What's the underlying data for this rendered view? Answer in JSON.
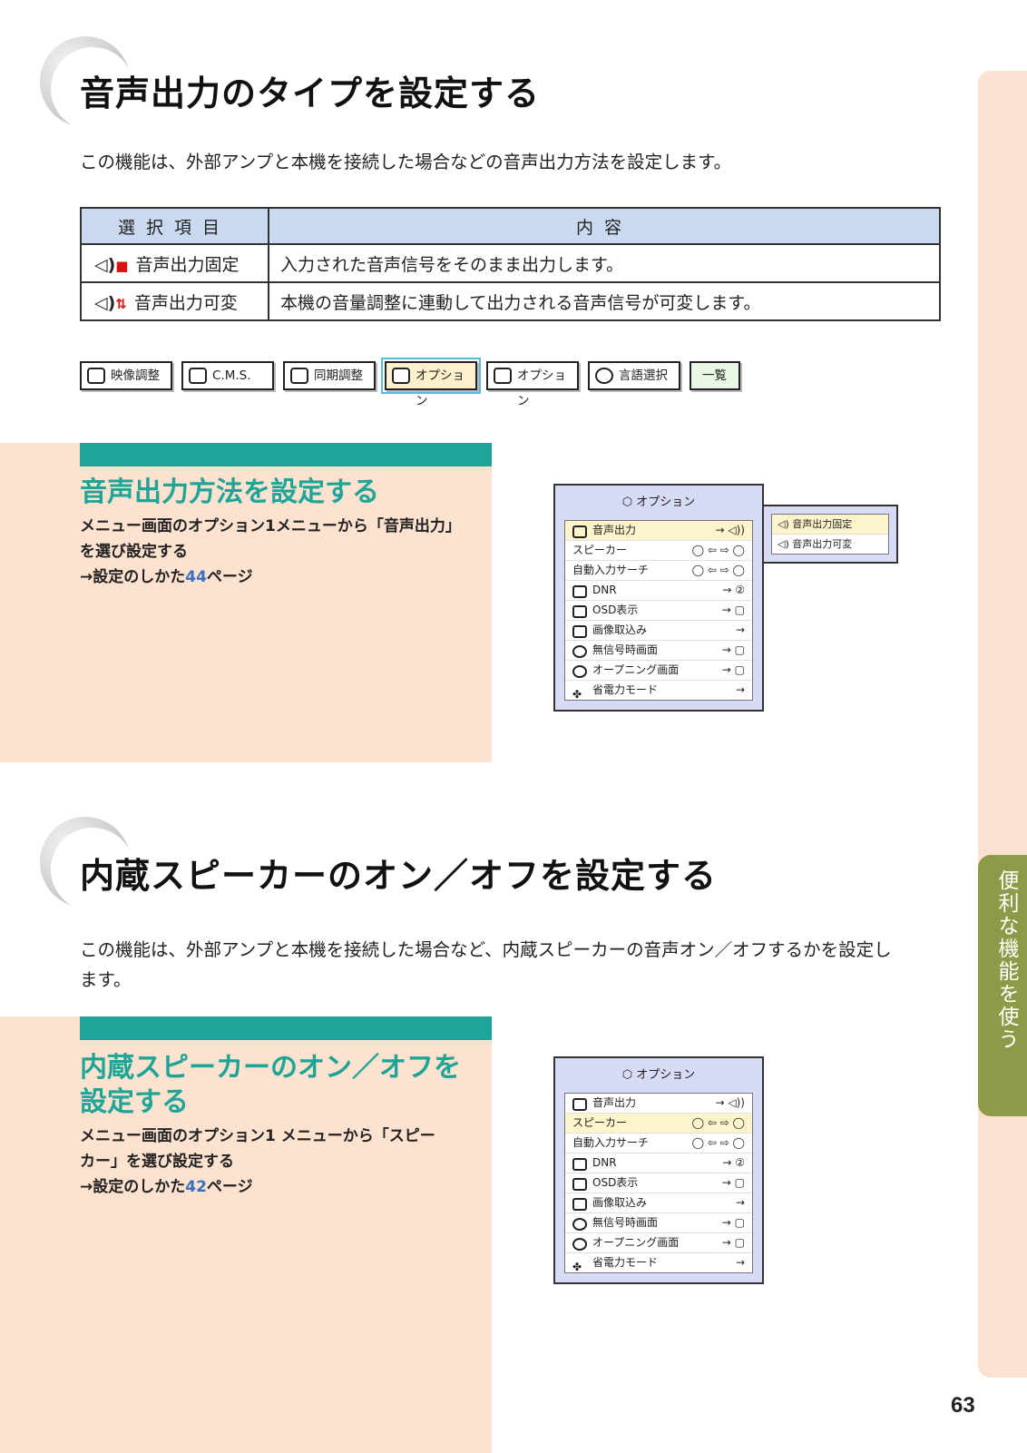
{
  "section1": {
    "title": "音声出力のタイプを設定する",
    "intro": "この機能は、外部アンプと本機を接続した場合などの音声出力方法を設定します。",
    "table": {
      "header": [
        "選択項目",
        "内容"
      ],
      "rows": [
        {
          "item": "音声出力固定",
          "desc": "入力された音声信号をそのまま出力します。"
        },
        {
          "item": "音声出力可変",
          "desc": "本機の音量調整に連動して出力される音声信号が可変します。"
        }
      ]
    }
  },
  "menu_tabs": [
    {
      "label": "映像調整",
      "icon": "picture-icon"
    },
    {
      "label": "C.M.S.",
      "icon": "cms-icon"
    },
    {
      "label": "同期調整",
      "icon": "sync-icon"
    },
    {
      "label": "オプション",
      "icon": "option1-icon",
      "active": true
    },
    {
      "label": "オプション",
      "icon": "option2-icon"
    },
    {
      "label": "言語選択",
      "icon": "language-icon"
    },
    {
      "label": "一覧",
      "icon": ""
    }
  ],
  "sub1": {
    "heading": "音声出力方法を設定する",
    "line1": "メニュー画面のオプション1メニューから「音声出力」",
    "line2": "を選び設定する",
    "ref_prefix": "→設定のしかた",
    "ref_page": "44",
    "ref_suffix": "ページ"
  },
  "osd": {
    "title": "オプション",
    "items": [
      {
        "label": "音声出力",
        "value": "→ ◁))"
      },
      {
        "label": "スピーカー",
        "value": "◯ ⇦ ⇨ ◯"
      },
      {
        "label": "自動入力サーチ",
        "value": "◯ ⇦ ⇨ ◯"
      },
      {
        "label": "DNR",
        "value": "→ ②"
      },
      {
        "label": "OSD表示",
        "value": "→ ▢"
      },
      {
        "label": "画像取込み",
        "value": "→"
      },
      {
        "label": "無信号時画面",
        "value": "→ ▢"
      },
      {
        "label": "オープニング画面",
        "value": "→ ▢"
      },
      {
        "label": "省電力モード",
        "value": "→"
      }
    ],
    "submenu": [
      "音声出力固定",
      "音声出力可変"
    ]
  },
  "section2": {
    "title": "内蔵スピーカーのオン／オフを設定する",
    "intro_line1": "この機能は、外部アンプと本機を接続した場合など、内蔵スピーカーの音声オン／オフするかを設定し",
    "intro_line2": "ます。"
  },
  "sub2": {
    "heading_line1": "内蔵スピーカーのオン／オフを",
    "heading_line2": "設定する",
    "line1": "メニュー画面のオプション1 メニューから「スピー",
    "line2": "カー」を選び設定する",
    "ref_prefix": "→設定のしかた",
    "ref_page": "42",
    "ref_suffix": "ページ"
  },
  "side_tab": "便利な機能を使う",
  "page_number": "63"
}
